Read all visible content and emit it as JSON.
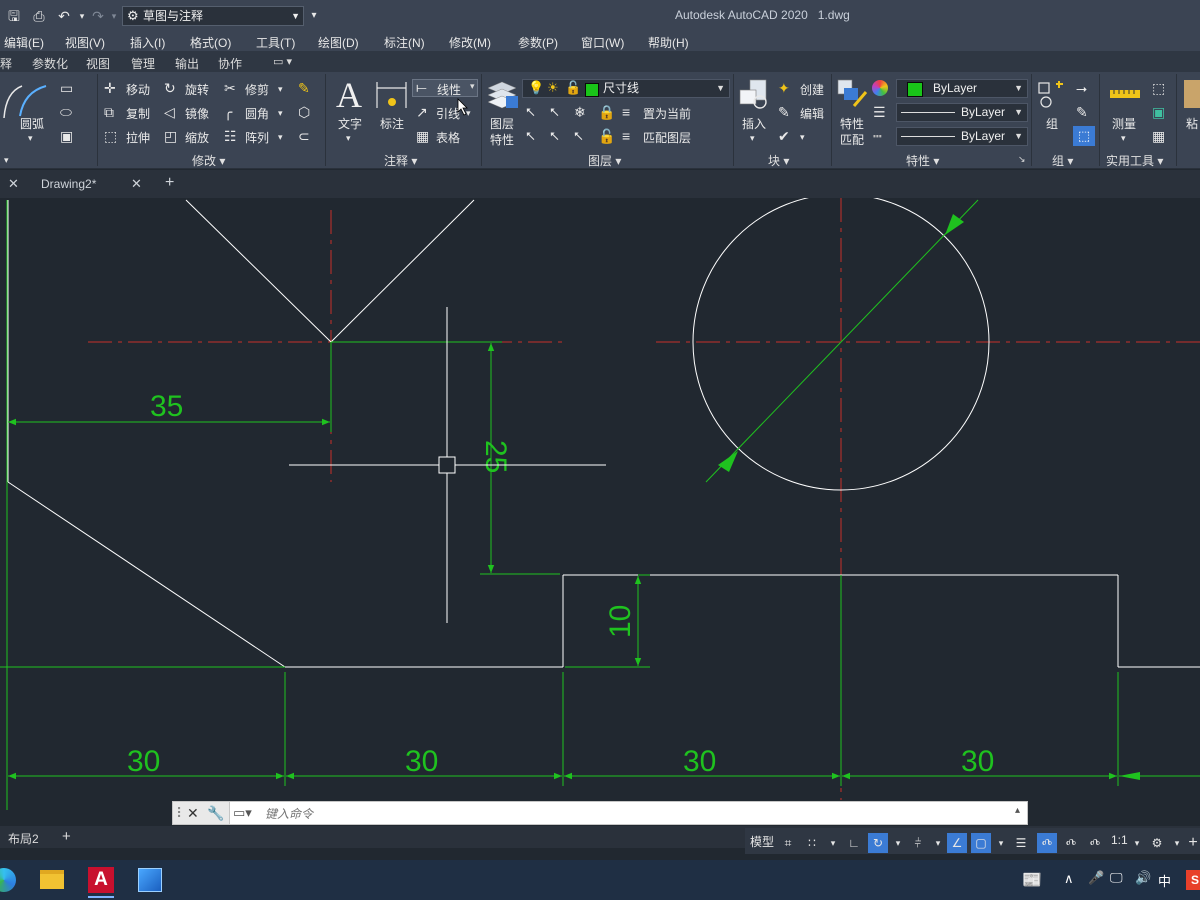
{
  "titlebar": {
    "workspace": "草图与注释",
    "app_title": "Autodesk AutoCAD 2020",
    "file_name": "1.dwg"
  },
  "menu": [
    "编辑(E)",
    "视图(V)",
    "插入(I)",
    "格式(O)",
    "工具(T)",
    "绘图(D)",
    "标注(N)",
    "修改(M)",
    "参数(P)",
    "窗口(W)",
    "帮助(H)"
  ],
  "ribbon_tabs": [
    "释",
    "参数化",
    "视图",
    "管理",
    "输出",
    "协作"
  ],
  "ribbon": {
    "draw": {
      "arc": "圆弧"
    },
    "modify": {
      "title": "修改",
      "move": "移动",
      "rotate": "旋转",
      "trim": "修剪",
      "copy": "复制",
      "mirror": "镜像",
      "fillet": "圆角",
      "stretch": "拉伸",
      "scale": "缩放",
      "array": "阵列"
    },
    "annotation": {
      "title": "注释",
      "text": "文字",
      "dimension": "标注",
      "linear": "线性",
      "leader": "引线",
      "table": "表格"
    },
    "layers": {
      "title": "图层",
      "layer_props_1": "图层",
      "layer_props_2": "特性",
      "current_layer": "尺寸线",
      "set_current": "置为当前",
      "match_layer": "匹配图层"
    },
    "block": {
      "title": "块",
      "insert": "插入",
      "create": "创建",
      "edit": "编辑"
    },
    "properties": {
      "title": "特性",
      "match_1": "特性",
      "match_2": "匹配",
      "color": "ByLayer",
      "linetype": "ByLayer",
      "lineweight": "ByLayer"
    },
    "groups": {
      "title": "组",
      "group": "组"
    },
    "utilities": {
      "title": "实用工具",
      "measure": "测量"
    },
    "clipboard": {
      "paste": "粘"
    },
    "colors": {
      "layer_swatch": "#19c519"
    }
  },
  "doc_tabs": {
    "active": "Drawing2*"
  },
  "drawing": {
    "dims": {
      "d35": "35",
      "d25": "25",
      "d10": "10",
      "d30a": "30",
      "d30b": "30",
      "d30c": "30",
      "d30d": "30"
    },
    "colors": {
      "dim": "#1fc21f",
      "center": "#c8302a",
      "geometry": "#ffffff",
      "background": "#212830"
    }
  },
  "command_line": {
    "placeholder": "键入命令"
  },
  "layout_tabs": {
    "current": "布局2"
  },
  "statusbar": {
    "model": "模型",
    "scale": "1:1"
  },
  "taskbar": {
    "ime": "中"
  }
}
